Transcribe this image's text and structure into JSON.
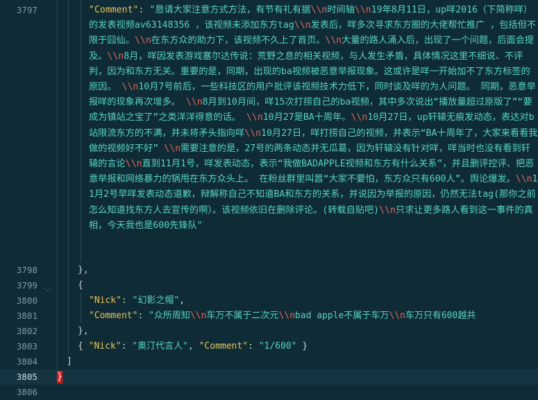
{
  "editor": {
    "line_numbers": [
      "3797",
      "3798",
      "3799",
      "3800",
      "3801",
      "3802",
      "3803",
      "3804",
      "3805",
      "3806"
    ],
    "block1": {
      "key": "\"Comment\"",
      "colon": ": ",
      "segments": [
        {
          "t": "\"恳请大家注意方式方法，有节有礼有据",
          "c": "str"
        },
        {
          "t": "\\\\n",
          "c": "esc"
        },
        {
          "t": "时间轴",
          "c": "str"
        },
        {
          "t": "\\\\n",
          "c": "esc"
        },
        {
          "t": "19年8月11日，up咩2016（下简称咩）的发表视频av63148356 ，该视频未添加东方tag",
          "c": "str"
        },
        {
          "t": "\\\\n",
          "c": "esc"
        },
        {
          "t": "发表后，咩多次寻求东方圈的大佬帮忙推广 ，包括但不限于囧仙。",
          "c": "str"
        },
        {
          "t": "\\\\n",
          "c": "esc"
        },
        {
          "t": "在东方众的助力下，该视频不久上了首页。",
          "c": "str"
        },
        {
          "t": "\\\\n",
          "c": "esc"
        },
        {
          "t": "大量的路人涌入后，出现了一个问题，后面会提及。",
          "c": "str"
        },
        {
          "t": "\\\\n",
          "c": "esc"
        },
        {
          "t": "8月，咩因发表游戏塞尔达传说：荒野之息的相关视频，与人发生矛盾，具体情况这里不细说、不评判，因为和东方无关。重要的是，同期，出现的bа视频被恶意举报现象。这或许是咩一开始加不了东方标签的原因。 ",
          "c": "str"
        },
        {
          "t": "\\\\n",
          "c": "esc"
        },
        {
          "t": "10月7号前后，一些科技区的用户批评该视频技术力低下，同时谈及咩的为人问题。 同期，恶意举报咩的现象再次增多。 ",
          "c": "str"
        },
        {
          "t": "\\\\n",
          "c": "esc"
        },
        {
          "t": "8月到10月间，咩15次打捞自己的ba视频，其中多次说出“播放量超过原版了”“要成为镇站之宝了”之类洋洋得意的话。 ",
          "c": "str"
        },
        {
          "t": "\\\\n",
          "c": "esc"
        },
        {
          "t": "10月27是BA十周年。",
          "c": "str"
        },
        {
          "t": "\\\\n",
          "c": "esc"
        },
        {
          "t": "10月27日，up轩辕无痕发动态，表达对b站限流东方的不满，并未将矛头指向咩",
          "c": "str"
        },
        {
          "t": "\\\\n",
          "c": "esc"
        },
        {
          "t": "10月27日，咩打捞自己的视频，并表示“BA十周年了，大家来看看我做的视频好不好” ",
          "c": "str"
        },
        {
          "t": "\\\\n",
          "c": "esc"
        },
        {
          "t": "需要注意的是，27号的两条动态并无瓜葛，因为轩辕没有针对咩，咩当时也没有看到轩辕的言论",
          "c": "str"
        },
        {
          "t": "\\\\n",
          "c": "esc"
        },
        {
          "t": "直到11月1号，咩发表动态，表示“我做BADAPPLE视频和东方有什么关系”，并且删评控评、把恶意举报和网络暴力的锅甩在东方众头上。 在粉丝群里叫嚣“大家不要怕，东方众只有600人”。舆论爆发。",
          "c": "str"
        },
        {
          "t": "\\\\n",
          "c": "esc"
        },
        {
          "t": "11月2号早咩发表动态道歉，辩解称自己不知道BA和东方的关系，并说因为举报的原因，仍然无法tag(那你之前怎么知道找东方人去宣传的啊）。该视频依旧在删除评论。(转载自贴吧)",
          "c": "str"
        },
        {
          "t": "\\\\n",
          "c": "esc"
        },
        {
          "t": "只求让更多路人看到这一事件的真相，今天我也是600先锋队\"",
          "c": "str"
        }
      ]
    },
    "line3798": "},",
    "line3799": "{",
    "line3800": {
      "key": "\"Nick\"",
      "colon": ": ",
      "value": "\"幻影之帽\"",
      "comma": ","
    },
    "line3801": {
      "key": "\"Comment\"",
      "colon": ": ",
      "segments": [
        {
          "t": "\"众所周知",
          "c": "str"
        },
        {
          "t": "\\\\n",
          "c": "esc"
        },
        {
          "t": "车万不属于二次元",
          "c": "str"
        },
        {
          "t": "\\\\n",
          "c": "esc"
        },
        {
          "t": "bad apple不属于车万",
          "c": "str"
        },
        {
          "t": "\\\\n",
          "c": "esc"
        },
        {
          "t": "车万只有600越共",
          "c": "str"
        }
      ]
    },
    "line3802": "},",
    "line3803": {
      "open": "{ ",
      "key1": "\"Nick\"",
      "colon1": ": ",
      "val1": "\"奥汀代言人\"",
      "sep": ", ",
      "key2": "\"Comment\"",
      "colon2": ": ",
      "val2": "\"1/600\"",
      "close": " }"
    },
    "line3804": "]",
    "line3805": "}"
  },
  "colors": {
    "background": "#0f2b36",
    "key": "#e7c45a",
    "string": "#57d4c4",
    "escape": "#e06a5a",
    "cursor": "#d81b1b"
  }
}
